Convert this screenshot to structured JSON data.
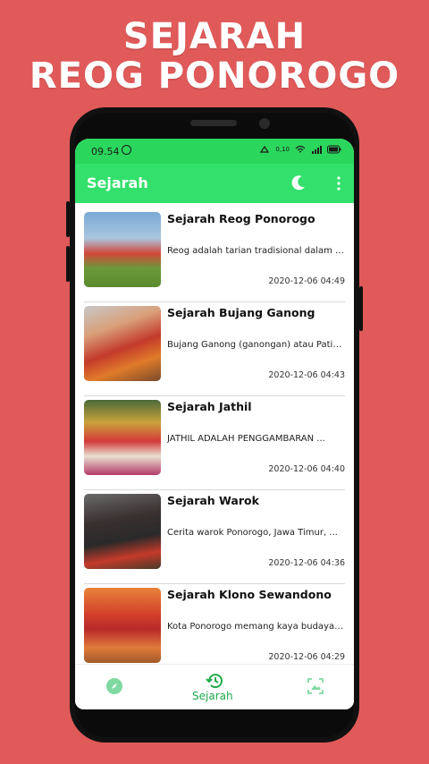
{
  "promo": {
    "line1": "SEJARAH",
    "line2": "REOG PONOROGO"
  },
  "status_bar": {
    "time": "09.54",
    "network_speed": "0,10"
  },
  "app_bar": {
    "title": "Sejarah"
  },
  "articles": [
    {
      "title": "Sejarah Reog Ponorogo",
      "excerpt": "Reog adalah tarian tradisional dalam are...",
      "date": "2020-12-06 04:49"
    },
    {
      "title": "Sejarah Bujang Ganong",
      "excerpt": "Bujang Ganong (ganongan) atau Patih ...",
      "date": "2020-12-06 04:43"
    },
    {
      "title": "Sejarah Jathil",
      "excerpt": "JATHIL ADALAH PENGGAMBARAN ...",
      "date": "2020-12-06 04:40"
    },
    {
      "title": "Sejarah Warok",
      "excerpt": "Cerita warok Ponorogo, Jawa Timur, ...",
      "date": "2020-12-06 04:36"
    },
    {
      "title": "Sejarah Klono Sewandono",
      "excerpt": "Kota Ponorogo memang kaya budaya da...",
      "date": "2020-12-06 04:29"
    }
  ],
  "bottom_nav": {
    "active_label": "Sejarah"
  },
  "colors": {
    "background": "#e05a5a",
    "status_bar": "#2bd65c",
    "app_bar": "#33e06c",
    "accent": "#1faa4b"
  },
  "icons": [
    "whatsapp-icon",
    "moon-icon",
    "overflow-menu-icon",
    "compass-icon",
    "history-icon",
    "image-icon"
  ]
}
